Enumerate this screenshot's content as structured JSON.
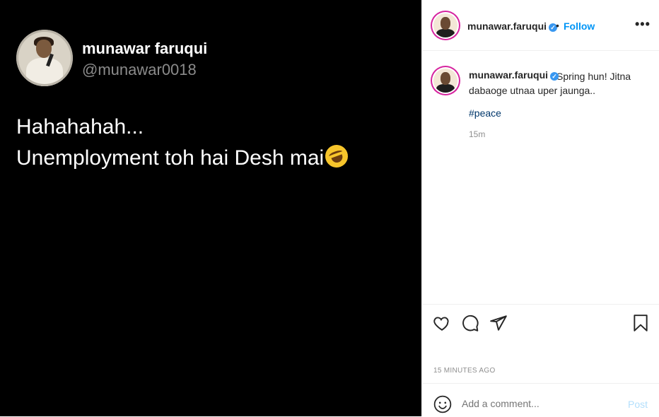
{
  "tweet": {
    "display_name": "munawar faruqui",
    "handle": "@munawar0018",
    "line1": "Hahahahah...",
    "line2": "Unemployment toh hai Desh mai",
    "emoji": "rolling-on-floor-laughing-emoji"
  },
  "header": {
    "username": "munawar.faruqui",
    "separator": "•",
    "follow_label": "Follow",
    "more_label": "•••"
  },
  "caption": {
    "username": "munawar.faruqui",
    "text": "Spring hun! Jitna dabaoge utnaa uper jaunga..",
    "hashtag": "#peace",
    "age": "15m"
  },
  "actions": {
    "icons": [
      "heart-icon",
      "comment-icon",
      "share-icon",
      "bookmark-icon"
    ]
  },
  "post_time": "15 MINUTES AGO",
  "comment": {
    "placeholder": "Add a comment...",
    "post_label": "Post"
  },
  "colors": {
    "link_blue": "#0095f6",
    "hashtag": "#00376b",
    "verified": "#3897f0",
    "story_ring": "#d6249f"
  }
}
